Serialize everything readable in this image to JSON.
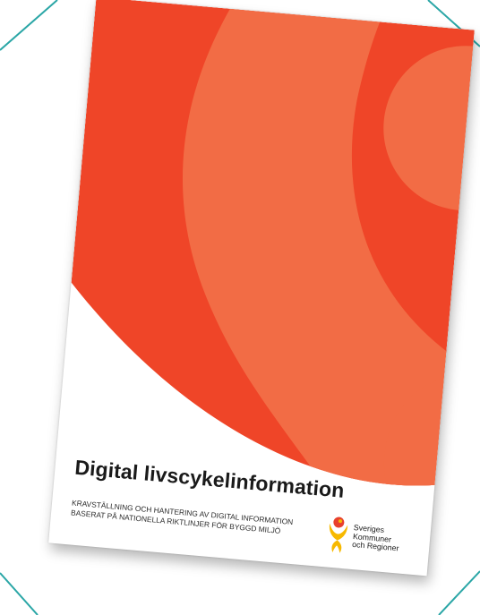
{
  "document": {
    "title": "Digital livscykelinformation",
    "subtitle_lines": [
      "KRAVSTÄLLNING OCH HANTERING AV DIGITAL INFORMATION",
      "BASERAT PÅ NATIONELLA RIKTLINJER FÖR BYGGD MILJÖ"
    ]
  },
  "publisher_logo": {
    "icon": "skr-figure-logo-icon",
    "lines": [
      "Sveriges",
      "Kommuner",
      "och Regioner"
    ]
  },
  "colors": {
    "background": "#ffffff",
    "deco_line": "#2aa6a6",
    "cover_orange_dark": "#ef4528",
    "cover_orange_light": "#f26c45",
    "logo_yellow": "#f7b900",
    "logo_red": "#e8402c"
  }
}
